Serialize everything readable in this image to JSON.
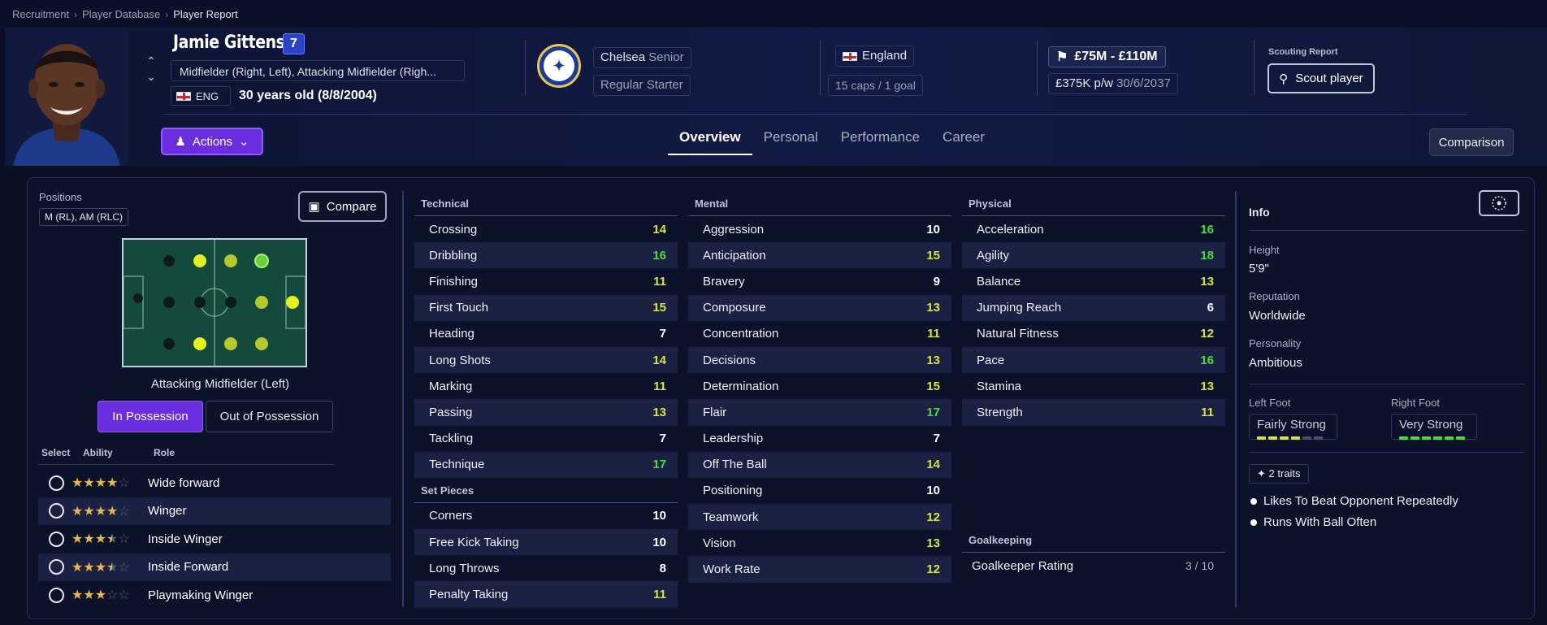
{
  "breadcrumb": [
    "Recruitment",
    "Player Database",
    "Player Report"
  ],
  "player": {
    "name": "Jamie Gittens",
    "number": "7",
    "positions": "Midfielder (Right, Left), Attacking Midfielder (Righ...",
    "nationality_code": "ENG",
    "age_text": "30 years old (8/8/2004)"
  },
  "club": {
    "name": "Chelsea",
    "squad": "Senior",
    "status": "Regular Starter"
  },
  "nation": {
    "name": "England",
    "caps": "15 caps / 1 goal"
  },
  "contract": {
    "value_range": "£75M - £110M",
    "wage": "£375K p/w",
    "expiry": "30/6/2037"
  },
  "scouting": {
    "label": "Scouting Report",
    "button": "Scout player"
  },
  "actions_label": "Actions",
  "tabs": [
    {
      "label": "Overview",
      "active": true
    },
    {
      "label": "Personal",
      "active": false
    },
    {
      "label": "Performance",
      "active": false
    },
    {
      "label": "Career",
      "active": false
    }
  ],
  "comparison_label": "Comparison",
  "left": {
    "positions_label": "Positions",
    "positions_tag": "M (RL), AM (RLC)",
    "compare_label": "Compare",
    "selected_position": "Attacking Midfielder (Left)",
    "in_possession": "In Possession",
    "out_possession": "Out of Possession",
    "role_headers": [
      "Select",
      "Ability",
      "Role"
    ],
    "roles": [
      {
        "name": "Wide forward",
        "stars": 4
      },
      {
        "name": "Winger",
        "stars": 4
      },
      {
        "name": "Inside Winger",
        "stars": 3.5
      },
      {
        "name": "Inside Forward",
        "stars": 3.5
      },
      {
        "name": "Playmaking Winger",
        "stars": 3
      }
    ]
  },
  "technical": {
    "title": "Technical",
    "attrs": [
      {
        "name": "Crossing",
        "value": 14
      },
      {
        "name": "Dribbling",
        "value": 16
      },
      {
        "name": "Finishing",
        "value": 11
      },
      {
        "name": "First Touch",
        "value": 15
      },
      {
        "name": "Heading",
        "value": 7
      },
      {
        "name": "Long Shots",
        "value": 14
      },
      {
        "name": "Marking",
        "value": 11
      },
      {
        "name": "Passing",
        "value": 13
      },
      {
        "name": "Tackling",
        "value": 7
      },
      {
        "name": "Technique",
        "value": 17
      }
    ]
  },
  "set_pieces": {
    "title": "Set Pieces",
    "attrs": [
      {
        "name": "Corners",
        "value": 10
      },
      {
        "name": "Free Kick Taking",
        "value": 10
      },
      {
        "name": "Long Throws",
        "value": 8
      },
      {
        "name": "Penalty Taking",
        "value": 11
      }
    ]
  },
  "mental": {
    "title": "Mental",
    "attrs": [
      {
        "name": "Aggression",
        "value": 10
      },
      {
        "name": "Anticipation",
        "value": 15
      },
      {
        "name": "Bravery",
        "value": 9
      },
      {
        "name": "Composure",
        "value": 13
      },
      {
        "name": "Concentration",
        "value": 11
      },
      {
        "name": "Decisions",
        "value": 13
      },
      {
        "name": "Determination",
        "value": 15
      },
      {
        "name": "Flair",
        "value": 17
      },
      {
        "name": "Leadership",
        "value": 7
      },
      {
        "name": "Off The Ball",
        "value": 14
      },
      {
        "name": "Positioning",
        "value": 10
      },
      {
        "name": "Teamwork",
        "value": 12
      },
      {
        "name": "Vision",
        "value": 13
      },
      {
        "name": "Work Rate",
        "value": 12
      }
    ]
  },
  "physical": {
    "title": "Physical",
    "attrs": [
      {
        "name": "Acceleration",
        "value": 16
      },
      {
        "name": "Agility",
        "value": 18
      },
      {
        "name": "Balance",
        "value": 13
      },
      {
        "name": "Jumping Reach",
        "value": 6
      },
      {
        "name": "Natural Fitness",
        "value": 12
      },
      {
        "name": "Pace",
        "value": 16
      },
      {
        "name": "Stamina",
        "value": 13
      },
      {
        "name": "Strength",
        "value": 11
      }
    ]
  },
  "goalkeeping": {
    "title": "Goalkeeping",
    "label": "Goalkeeper Rating",
    "value": "3 / 10"
  },
  "info": {
    "title": "Info",
    "height_label": "Height",
    "height": "5'9\"",
    "reputation_label": "Reputation",
    "reputation": "Worldwide",
    "personality_label": "Personality",
    "personality": "Ambitious",
    "left_foot_label": "Left Foot",
    "left_foot": "Fairly Strong",
    "left_foot_level": 4,
    "right_foot_label": "Right Foot",
    "right_foot": "Very Strong",
    "right_foot_level": 6,
    "traits_label": "2 traits",
    "traits": [
      "Likes To Beat Opponent Repeatedly",
      "Runs With Ball Often"
    ]
  },
  "colors": {
    "accent": "#6a2de0",
    "yellow": "#d8e62d",
    "green": "#4bdc3a",
    "star": "#e8b84a"
  }
}
